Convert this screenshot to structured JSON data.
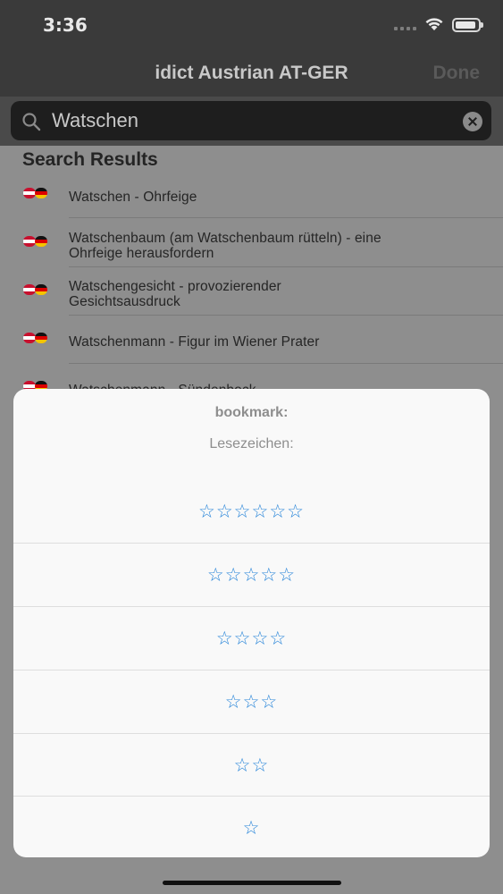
{
  "status": {
    "time": "3:36"
  },
  "nav": {
    "title": "idict Austrian AT-GER",
    "done_label": "Done"
  },
  "search": {
    "value": "Watschen"
  },
  "results": {
    "header": "Search Results",
    "items": [
      {
        "line1": "Watschen - Ohrfeige",
        "line2": ""
      },
      {
        "line1": "Watschenbaum (am Watschenbaum rütteln) - eine",
        "line2": "Ohrfeige herausfordern"
      },
      {
        "line1": "Watschengesicht - provozierender",
        "line2": "Gesichtsausdruck"
      },
      {
        "line1": "Watschenmann - Figur im Wiener Prater",
        "line2": ""
      },
      {
        "line1": "Watschenmann - Sündenbock",
        "line2": ""
      }
    ]
  },
  "sheet": {
    "title": "bookmark:",
    "message": "Lesezeichen:",
    "options": [
      {
        "label": "☆☆☆☆☆☆",
        "stars": 6
      },
      {
        "label": "☆☆☆☆☆",
        "stars": 5
      },
      {
        "label": "☆☆☆☆",
        "stars": 4
      },
      {
        "label": "☆☆☆",
        "stars": 3
      },
      {
        "label": "☆☆",
        "stars": 2
      },
      {
        "label": "☆",
        "stars": 1
      }
    ]
  },
  "colors": {
    "accent": "#2a86d9",
    "sheet_background": "#f9f9f9",
    "dim_background": "#8e8e8e"
  },
  "icons": {
    "flags": [
      "austria-flag-icon",
      "germany-flag-icon"
    ],
    "search": "search-icon",
    "clear": "clear-icon"
  }
}
